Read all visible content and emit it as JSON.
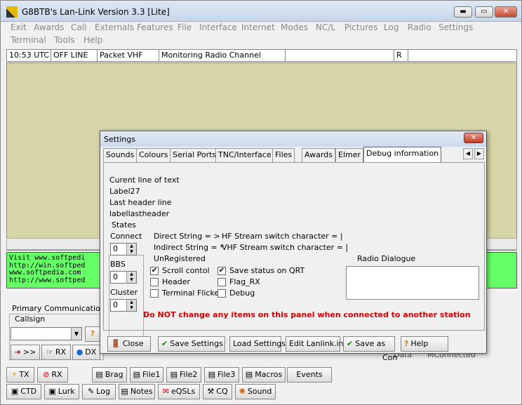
{
  "window": {
    "title": "G8BTB's Lan-Link Version 3.3 [Lite]",
    "btn_min": "▬",
    "btn_max": "▭",
    "btn_close": "✕"
  },
  "menu": [
    "Exit",
    "Awards",
    "Call",
    "Externals",
    "Features",
    "File",
    "Interface",
    "Internet",
    "Modes",
    "NC/L",
    "Pictures",
    "Log",
    "Radio",
    "Settings",
    "Terminal",
    "Tools",
    "Help"
  ],
  "status": {
    "time": "10:53 UTC",
    "mode": "OFF LINE",
    "band": "Packet VHF",
    "activity": "Monitoring Radio Channel",
    "empty": "",
    "flag": "R"
  },
  "monitor_lines": [
    "Visit www.softpedi",
    "http://win.softped",
    "www.softpedia.com ",
    "http://www.softped"
  ],
  "left_panel": {
    "primary": "Primary Communications M",
    "callsign": "Callsign",
    "send_btn": ">>",
    "rx_btn": "RX",
    "dx_btn": "DX"
  },
  "bottom_right": {
    "data": "Data",
    "mconnected": "MConnected",
    "con": "Con"
  },
  "toolbar1": {
    "tx": "TX",
    "rx": "RX",
    "brag": "Brag",
    "file1": "File1",
    "file2": "File2",
    "file3": "File3",
    "macros": "Macros",
    "events": "Events"
  },
  "toolbar2": {
    "ctd": "CTD",
    "lurk": "Lurk",
    "log": "Log",
    "notes": "Notes",
    "eqsls": "eQSLs",
    "cq": "CQ",
    "sound": "Sound"
  },
  "settings": {
    "title": "Settings",
    "tabs": [
      "Sounds",
      "Colours",
      "Serial Ports",
      "TNC/Interface",
      "Files",
      "Awards",
      "Elmer",
      "Debug information"
    ],
    "current_line": "Curent line of text",
    "label27": "Label27",
    "last_header": "Last header line",
    "label_last_header": "labellastheader",
    "states": "States",
    "connect": "Connect",
    "connect_val": "0",
    "bbs": "BBS",
    "bbs_val": "0",
    "cluster": "Cluster",
    "cluster_val": "0",
    "direct": "Direct String = >",
    "indirect": "Indirect String = *",
    "unregistered": "UnRegistered",
    "hf_switch": "HF Stream switch character = |",
    "vhf_switch": "VHF Stream switch character = |",
    "scroll": "Scroll contol",
    "header": "Header",
    "term_flicker": "Terminal Flicker",
    "save_status": "Save status on QRT",
    "flag_rx": "Flag_RX",
    "debug": "Debug",
    "radio_dialogue": "Radio Dialogue",
    "warning": "Do NOT change any items on this panel when connected to another station",
    "btn_close": "Close",
    "btn_save": "Save Settings",
    "btn_load": "Load Settings",
    "btn_edit": "Edit Lanlink.ini",
    "btn_saveas": "Save as",
    "btn_help": "Help",
    "check_mark": "✔"
  },
  "colors": {
    "monitor_bg": "#d6d6a8",
    "green_bg": "#66ff66",
    "warning": "#d00000"
  }
}
